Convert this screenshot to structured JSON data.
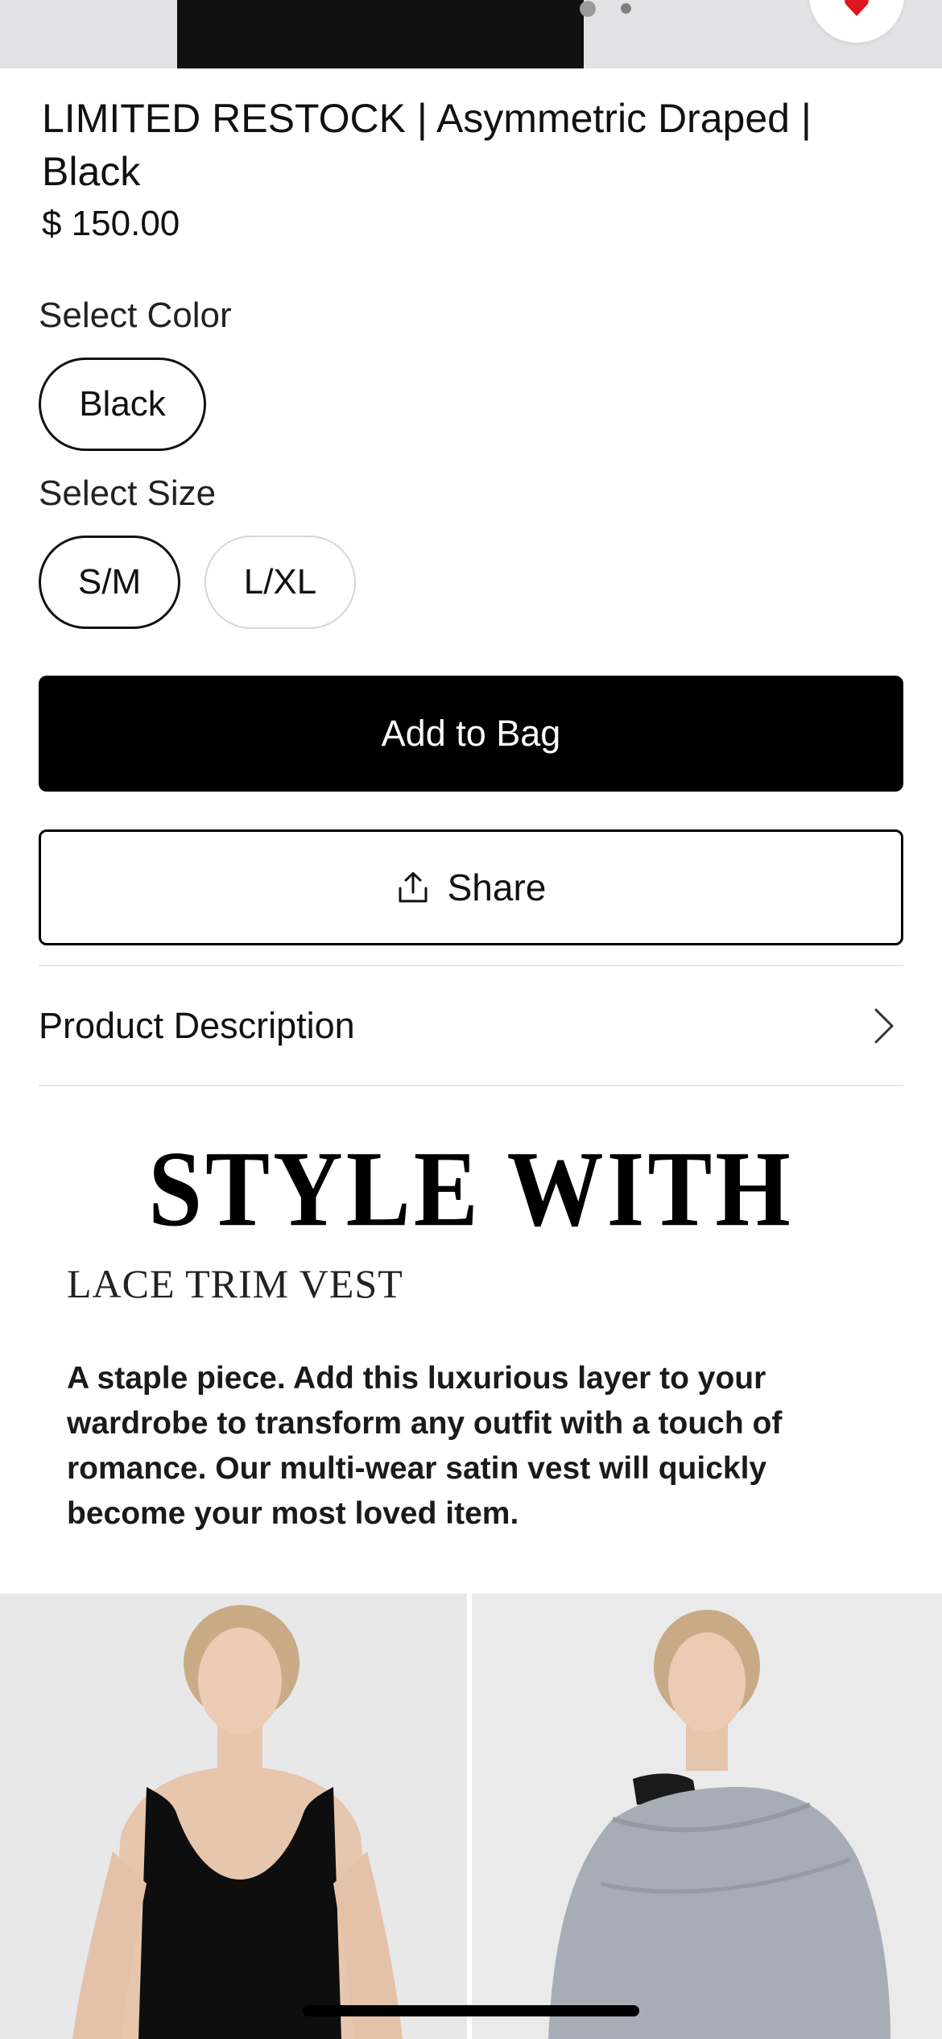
{
  "carousel": {
    "active_dot_index": 0,
    "dot_count": 2
  },
  "product": {
    "title": "LIMITED RESTOCK | Asymmetric Draped | Black",
    "price": "$ 150.00"
  },
  "color_selector": {
    "label": "Select Color",
    "options": [
      {
        "label": "Black",
        "selected": true
      }
    ]
  },
  "size_selector": {
    "label": "Select Size",
    "options": [
      {
        "label": "S/M",
        "selected": true
      },
      {
        "label": "L/XL",
        "selected": false
      }
    ]
  },
  "actions": {
    "add_to_bag_label": "Add to Bag",
    "share_label": "Share"
  },
  "description": {
    "label": "Product Description"
  },
  "style_with": {
    "heading": "STYLE WITH",
    "subheading": "LACE TRIM VEST",
    "body": "A staple piece. Add this luxurious layer to your wardrobe to transform any outfit with a touch of romance. Our multi-wear satin vest will quickly become your most loved item."
  },
  "colors": {
    "accent_heart": "#e0141e",
    "primary_button": "#000000"
  },
  "icons": {
    "favorite": "heart-icon",
    "share": "share-icon",
    "description_expand": "chevron-right-icon"
  }
}
